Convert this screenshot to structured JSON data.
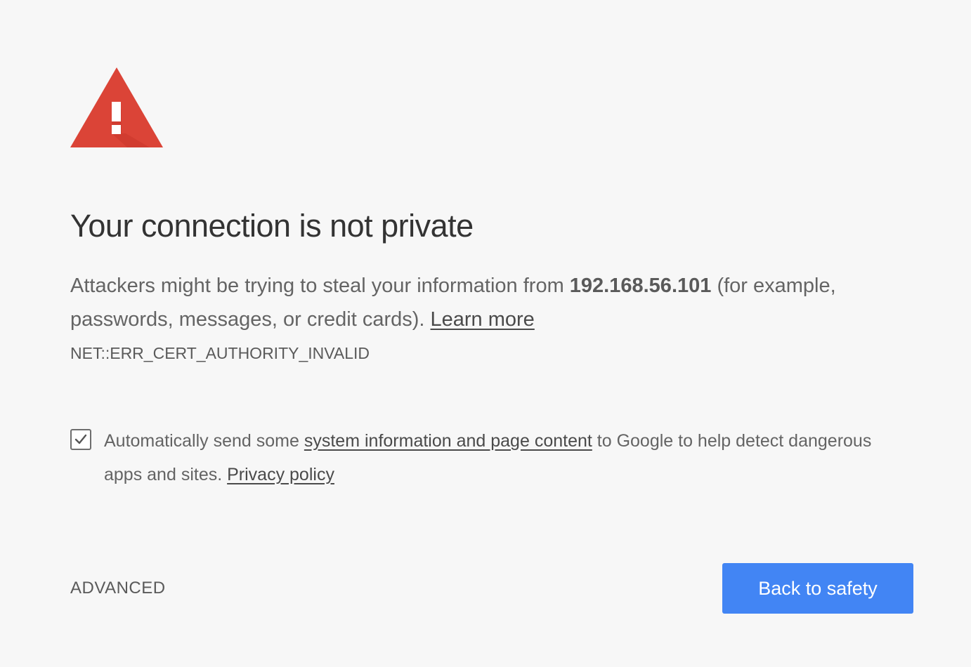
{
  "icon": "warning-triangle-icon",
  "colors": {
    "warning_red": "#db4437",
    "primary_blue": "#4285f4",
    "background": "#f7f7f7"
  },
  "heading": "Your connection is not private",
  "explanation": {
    "text_before": "Attackers might be trying to steal your information from ",
    "host": "192.168.56.101",
    "text_after": " (for example, passwords, messages, or credit cards). ",
    "learn_more_link": "Learn more"
  },
  "error_code": "NET::ERR_CERT_AUTHORITY_INVALID",
  "reporting": {
    "checked": true,
    "text_before": "Automatically send some ",
    "system_info_link": "system information and page content",
    "text_middle": " to Google to help detect dangerous apps and sites. ",
    "privacy_link": "Privacy policy"
  },
  "buttons": {
    "advanced": "ADVANCED",
    "back_to_safety": "Back to safety"
  }
}
